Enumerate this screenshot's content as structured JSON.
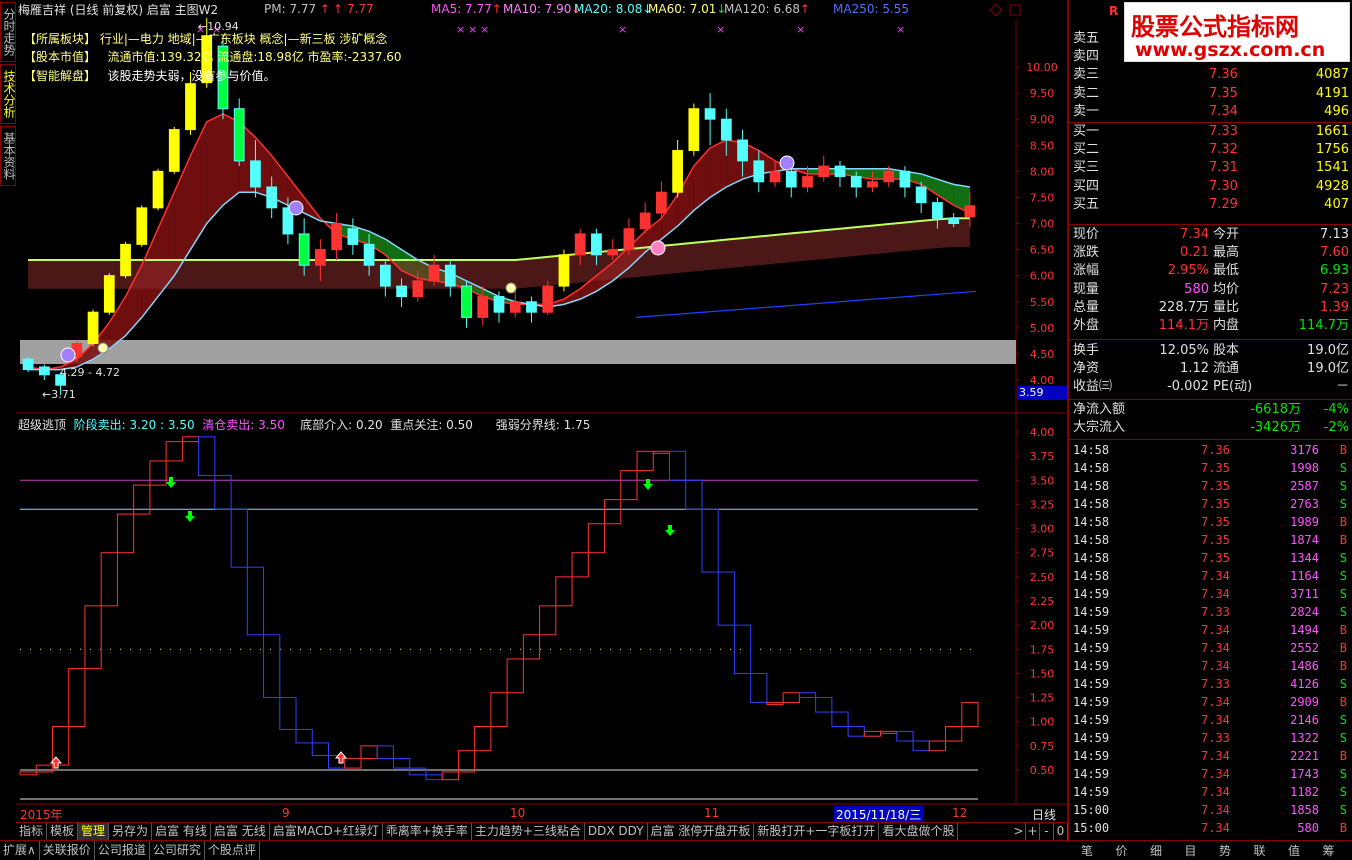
{
  "side_tabs": [
    "分时走势",
    "技术分析",
    "基本资料"
  ],
  "header": {
    "stock_name": "梅雁吉祥",
    "chart_mode": "(日线 前复权)",
    "layout": "启富 主图W2",
    "pm_label": "PM: 7.77",
    "pm_value": "7.77",
    "ma5": "MA5: 7.77",
    "ma10": "MA10: 7.90",
    "ma20": "MA20: 8.08",
    "ma60": "MA60: 7.01",
    "ma120": "MA120: 6.68",
    "ma250": "MA250: 5.55",
    "line2": "【所属板块】   行业|—电力   地域|—广东板块   概念|—新三板 涉矿概念",
    "line3_a": "【股本市值】",
    "line3_b": "流通市值:139.32亿   流通盘:18.98亿   市盈率:-2337.60",
    "line4_a": "【智能解盘】",
    "line4_b": "该股走势夫弱，没有参与价值。",
    "peak_label": "10.94",
    "low_label": "3.71",
    "range_label": "4.29 - 4.72"
  },
  "price_axis": [
    "10.00",
    "9.50",
    "9.00",
    "8.50",
    "8.00",
    "7.50",
    "7.00",
    "6.50",
    "6.00",
    "5.50",
    "5.00",
    "4.50",
    "4.00"
  ],
  "price_badge": "3.59",
  "indicator": {
    "title": "超级逃顶",
    "stage_sell": "阶段卖出: 3.20 : 3.50",
    "clear_sell": "清仓卖出: 3.50",
    "bottom_in": "底部介入: 0.20",
    "focus": "重点关注: 0.50",
    "strong_weak": "强弱分界线: 1.75"
  },
  "ind_axis": [
    "4.00",
    "3.75",
    "3.50",
    "3.25",
    "3.00",
    "2.75",
    "2.50",
    "2.25",
    "2.00",
    "1.75",
    "1.50",
    "1.25",
    "1.00",
    "0.75",
    "0.50"
  ],
  "date_axis": {
    "year": "2015年",
    "m9": "9",
    "m10": "10",
    "m11": "11",
    "m12": "12",
    "cursor_date": "2015/11/18/三",
    "period": "日线"
  },
  "toolbar": [
    "指标",
    "模板",
    "管理",
    "另存为",
    "启富 有线",
    "启富 无线",
    "启富MACD+红绿灯",
    "乖离率+换手率",
    "主力趋势+三线粘合",
    "DDX DDY",
    "启富 涨停开盘开板",
    "新股打开+一字板打开",
    "看大盘做个股"
  ],
  "toolbar_nav": [
    ">",
    "+",
    "-",
    "0"
  ],
  "bottom_bar": [
    "扩展∧",
    "关联报价",
    "公司报道",
    "公司研究",
    "个股点评"
  ],
  "logo": {
    "text": "股票公式指标网",
    "url": "www.gszx.com.cn",
    "r": "R",
    "e": "6"
  },
  "order_book": {
    "asks": [
      {
        "label": "卖五",
        "price": "",
        "vol": ""
      },
      {
        "label": "卖四",
        "price": "",
        "vol": "5480"
      },
      {
        "label": "卖三",
        "price": "7.36",
        "vol": "4087"
      },
      {
        "label": "卖二",
        "price": "7.35",
        "vol": "4191"
      },
      {
        "label": "卖一",
        "price": "7.34",
        "vol": "496"
      }
    ],
    "bids": [
      {
        "label": "买一",
        "price": "7.33",
        "vol": "1661"
      },
      {
        "label": "买二",
        "price": "7.32",
        "vol": "1756"
      },
      {
        "label": "买三",
        "price": "7.31",
        "vol": "1541"
      },
      {
        "label": "买四",
        "price": "7.30",
        "vol": "4928"
      },
      {
        "label": "买五",
        "price": "7.29",
        "vol": "407"
      }
    ]
  },
  "quote": [
    {
      "l1": "现价",
      "v1": "7.34",
      "c1": "red",
      "l2": "今开",
      "v2": "7.13",
      "c2": "white"
    },
    {
      "l1": "涨跌",
      "v1": "0.21",
      "c1": "red",
      "l2": "最高",
      "v2": "7.60",
      "c2": "red"
    },
    {
      "l1": "涨幅",
      "v1": "2.95%",
      "c1": "red",
      "l2": "最低",
      "v2": "6.93",
      "c2": "green"
    },
    {
      "l1": "现量",
      "v1": "580",
      "c1": "magenta",
      "l2": "均价",
      "v2": "7.23",
      "c2": "red"
    },
    {
      "l1": "总量",
      "v1": "228.7万",
      "c1": "white",
      "l2": "量比",
      "v2": "1.39",
      "c2": "red"
    },
    {
      "l1": "外盘",
      "v1": "114.1万",
      "c1": "red",
      "l2": "内盘",
      "v2": "114.7万",
      "c2": "green"
    }
  ],
  "fund": [
    {
      "l1": "换手",
      "v1": "12.05%",
      "l2": "股本",
      "v2": "19.0亿"
    },
    {
      "l1": "净资",
      "v1": "1.12",
      "l2": "流通",
      "v2": "19.0亿"
    },
    {
      "l1": "收益㈢",
      "v1": "-0.002",
      "l2": "PE(动)",
      "v2": "－"
    }
  ],
  "flows": [
    {
      "label": "净流入额",
      "value": "-6618万",
      "pct": "-4%"
    },
    {
      "label": "大宗流入",
      "value": "-3426万",
      "pct": "-2%"
    }
  ],
  "ticks": [
    {
      "t": "14:58",
      "p": "7.36",
      "v": "3176",
      "s": "B"
    },
    {
      "t": "14:58",
      "p": "7.35",
      "v": "1998",
      "s": "S"
    },
    {
      "t": "14:58",
      "p": "7.35",
      "v": "2587",
      "s": "S"
    },
    {
      "t": "14:58",
      "p": "7.35",
      "v": "2763",
      "s": "S"
    },
    {
      "t": "14:58",
      "p": "7.35",
      "v": "1989",
      "s": "B"
    },
    {
      "t": "14:58",
      "p": "7.35",
      "v": "1874",
      "s": "B"
    },
    {
      "t": "14:58",
      "p": "7.35",
      "v": "1344",
      "s": "S"
    },
    {
      "t": "14:58",
      "p": "7.34",
      "v": "1164",
      "s": "S"
    },
    {
      "t": "14:59",
      "p": "7.34",
      "v": "3711",
      "s": "S"
    },
    {
      "t": "14:59",
      "p": "7.33",
      "v": "2824",
      "s": "S"
    },
    {
      "t": "14:59",
      "p": "7.34",
      "v": "1494",
      "s": "B"
    },
    {
      "t": "14:59",
      "p": "7.34",
      "v": "2552",
      "s": "B"
    },
    {
      "t": "14:59",
      "p": "7.34",
      "v": "1486",
      "s": "B"
    },
    {
      "t": "14:59",
      "p": "7.33",
      "v": "4126",
      "s": "S"
    },
    {
      "t": "14:59",
      "p": "7.34",
      "v": "2909",
      "s": "B"
    },
    {
      "t": "14:59",
      "p": "7.34",
      "v": "2146",
      "s": "S"
    },
    {
      "t": "14:59",
      "p": "7.33",
      "v": "1322",
      "s": "S"
    },
    {
      "t": "14:59",
      "p": "7.34",
      "v": "2221",
      "s": "B"
    },
    {
      "t": "14:59",
      "p": "7.34",
      "v": "1743",
      "s": "S"
    },
    {
      "t": "14:59",
      "p": "7.34",
      "v": "1182",
      "s": "S"
    },
    {
      "t": "15:00",
      "p": "7.34",
      "v": "1858",
      "s": "S"
    },
    {
      "t": "15:00",
      "p": "7.34",
      "v": "580",
      "s": "B"
    }
  ],
  "right_tabs": [
    "笔",
    "价",
    "细",
    "目",
    "势",
    "联",
    "值",
    "筹"
  ],
  "colors": {
    "up": "#ff3232",
    "down": "#54ffff",
    "yellow": "#ffff00",
    "border": "#800000"
  },
  "chart_data": {
    "type": "candlestick",
    "candles": [
      {
        "o": 4.4,
        "c": 4.2,
        "h": 4.45,
        "l": 4.15
      },
      {
        "o": 4.25,
        "c": 4.1,
        "h": 4.3,
        "l": 4.0
      },
      {
        "o": 4.1,
        "c": 3.9,
        "h": 4.15,
        "l": 3.71
      },
      {
        "o": 4.45,
        "c": 4.7,
        "h": 4.75,
        "l": 4.35
      },
      {
        "o": 4.7,
        "c": 5.3,
        "h": 5.35,
        "l": 4.65
      },
      {
        "o": 5.3,
        "c": 6.0,
        "h": 6.05,
        "l": 5.25
      },
      {
        "o": 6.0,
        "c": 6.6,
        "h": 6.65,
        "l": 5.95
      },
      {
        "o": 6.6,
        "c": 7.3,
        "h": 7.35,
        "l": 6.55
      },
      {
        "o": 7.3,
        "c": 8.0,
        "h": 8.05,
        "l": 7.25
      },
      {
        "o": 8.0,
        "c": 8.8,
        "h": 8.85,
        "l": 7.95
      },
      {
        "o": 8.8,
        "c": 9.68,
        "h": 9.9,
        "l": 8.7
      },
      {
        "o": 9.7,
        "c": 10.6,
        "h": 10.94,
        "l": 9.6
      },
      {
        "o": 10.4,
        "c": 9.2,
        "h": 10.6,
        "l": 9.0
      },
      {
        "o": 9.2,
        "c": 8.2,
        "h": 9.4,
        "l": 8.1
      },
      {
        "o": 8.2,
        "c": 7.7,
        "h": 8.6,
        "l": 7.5
      },
      {
        "o": 7.7,
        "c": 7.3,
        "h": 7.9,
        "l": 7.1
      },
      {
        "o": 7.3,
        "c": 6.8,
        "h": 7.5,
        "l": 6.6
      },
      {
        "o": 6.8,
        "c": 6.2,
        "h": 7.1,
        "l": 6.0
      },
      {
        "o": 6.2,
        "c": 6.5,
        "h": 6.7,
        "l": 5.9
      },
      {
        "o": 6.5,
        "c": 7.0,
        "h": 7.2,
        "l": 6.3
      },
      {
        "o": 6.9,
        "c": 6.6,
        "h": 7.1,
        "l": 6.4
      },
      {
        "o": 6.6,
        "c": 6.2,
        "h": 6.8,
        "l": 6.0
      },
      {
        "o": 6.2,
        "c": 5.8,
        "h": 6.3,
        "l": 5.6
      },
      {
        "o": 5.8,
        "c": 5.6,
        "h": 5.95,
        "l": 5.4
      },
      {
        "o": 5.6,
        "c": 5.9,
        "h": 6.1,
        "l": 5.5
      },
      {
        "o": 5.9,
        "c": 6.2,
        "h": 6.4,
        "l": 5.8
      },
      {
        "o": 6.2,
        "c": 5.8,
        "h": 6.3,
        "l": 5.6
      },
      {
        "o": 5.8,
        "c": 5.2,
        "h": 5.9,
        "l": 5.0
      },
      {
        "o": 5.2,
        "c": 5.6,
        "h": 5.8,
        "l": 5.05
      },
      {
        "o": 5.6,
        "c": 5.3,
        "h": 5.7,
        "l": 5.1
      },
      {
        "o": 5.3,
        "c": 5.5,
        "h": 5.75,
        "l": 5.2
      },
      {
        "o": 5.5,
        "c": 5.3,
        "h": 5.6,
        "l": 5.1
      },
      {
        "o": 5.3,
        "c": 5.8,
        "h": 5.9,
        "l": 5.25
      },
      {
        "o": 5.8,
        "c": 6.4,
        "h": 6.5,
        "l": 5.7
      },
      {
        "o": 6.4,
        "c": 6.8,
        "h": 6.9,
        "l": 6.2
      },
      {
        "o": 6.8,
        "c": 6.4,
        "h": 6.9,
        "l": 6.2
      },
      {
        "o": 6.4,
        "c": 6.5,
        "h": 6.7,
        "l": 6.3
      },
      {
        "o": 6.5,
        "c": 6.9,
        "h": 7.1,
        "l": 6.4
      },
      {
        "o": 6.9,
        "c": 7.2,
        "h": 7.4,
        "l": 6.8
      },
      {
        "o": 7.2,
        "c": 7.6,
        "h": 7.8,
        "l": 7.1
      },
      {
        "o": 7.6,
        "c": 8.4,
        "h": 8.6,
        "l": 7.5
      },
      {
        "o": 8.4,
        "c": 9.2,
        "h": 9.3,
        "l": 8.3
      },
      {
        "o": 9.2,
        "c": 9.0,
        "h": 9.5,
        "l": 8.5
      },
      {
        "o": 9.0,
        "c": 8.6,
        "h": 9.2,
        "l": 8.3
      },
      {
        "o": 8.6,
        "c": 8.2,
        "h": 8.8,
        "l": 7.9
      },
      {
        "o": 8.2,
        "c": 7.8,
        "h": 8.4,
        "l": 7.6
      },
      {
        "o": 7.8,
        "c": 8.0,
        "h": 8.2,
        "l": 7.7
      },
      {
        "o": 8.0,
        "c": 7.7,
        "h": 8.1,
        "l": 7.5
      },
      {
        "o": 7.7,
        "c": 7.9,
        "h": 8.1,
        "l": 7.6
      },
      {
        "o": 7.9,
        "c": 8.1,
        "h": 8.3,
        "l": 7.8
      },
      {
        "o": 8.1,
        "c": 7.9,
        "h": 8.2,
        "l": 7.7
      },
      {
        "o": 7.9,
        "c": 7.7,
        "h": 8.0,
        "l": 7.5
      },
      {
        "o": 7.7,
        "c": 7.8,
        "h": 8.0,
        "l": 7.6
      },
      {
        "o": 7.8,
        "c": 8.0,
        "h": 8.1,
        "l": 7.7
      },
      {
        "o": 8.0,
        "c": 7.7,
        "h": 8.1,
        "l": 7.5
      },
      {
        "o": 7.7,
        "c": 7.4,
        "h": 7.8,
        "l": 7.2
      },
      {
        "o": 7.4,
        "c": 7.1,
        "h": 7.5,
        "l": 6.9
      },
      {
        "o": 7.1,
        "c": 7.0,
        "h": 7.2,
        "l": 6.93
      },
      {
        "o": 7.13,
        "c": 7.34,
        "h": 7.6,
        "l": 6.93
      }
    ],
    "ma_fast": [
      4.25,
      4.2,
      4.25,
      4.4,
      4.7,
      5.1,
      5.6,
      6.2,
      6.9,
      7.6,
      8.3,
      8.95,
      9.1,
      8.95,
      8.65,
      8.3,
      7.9,
      7.5,
      7.1,
      6.8,
      6.7,
      6.6,
      6.4,
      6.1,
      5.95,
      5.9,
      5.85,
      5.75,
      5.6,
      5.5,
      5.45,
      5.45,
      5.45,
      5.55,
      5.75,
      6.0,
      6.25,
      6.55,
      6.85,
      7.1,
      7.55,
      8.1,
      8.45,
      8.6,
      8.55,
      8.4,
      8.2,
      8.05,
      7.95,
      7.95,
      7.95,
      7.9,
      7.85,
      7.85,
      7.85,
      7.75,
      7.55,
      7.35,
      7.2
    ],
    "ma_slow": [
      4.2,
      4.2,
      4.2,
      4.25,
      4.4,
      4.6,
      4.85,
      5.2,
      5.6,
      6.0,
      6.5,
      7.0,
      7.35,
      7.6,
      7.6,
      7.5,
      7.35,
      7.2,
      7.05,
      7.0,
      6.95,
      6.85,
      6.7,
      6.5,
      6.3,
      6.15,
      6.05,
      5.9,
      5.75,
      5.6,
      5.5,
      5.45,
      5.4,
      5.45,
      5.55,
      5.7,
      5.9,
      6.15,
      6.45,
      6.7,
      6.95,
      7.25,
      7.5,
      7.7,
      7.85,
      7.95,
      8.0,
      8.05,
      8.05,
      8.05,
      8.05,
      8.05,
      8.05,
      8.05,
      8.0,
      7.95,
      7.85,
      7.75,
      7.7
    ],
    "indicator_series": [
      0.45,
      0.48,
      0.55,
      0.95,
      1.55,
      2.2,
      2.75,
      3.15,
      3.45,
      3.7,
      3.9,
      3.95,
      3.55,
      3.2,
      2.6,
      1.9,
      1.25,
      0.92,
      0.78,
      0.65,
      0.52,
      0.62,
      0.75,
      0.62,
      0.52,
      0.45,
      0.4,
      0.48,
      0.7,
      0.95,
      1.3,
      1.65,
      1.9,
      2.2,
      2.5,
      2.75,
      3.05,
      3.3,
      3.6,
      3.8,
      3.8,
      3.5,
      3.2,
      2.55,
      2.0,
      1.5,
      1.2,
      1.2,
      1.3,
      1.25,
      1.1,
      0.95,
      0.85,
      0.9,
      0.9,
      0.8,
      0.7,
      0.8,
      0.95,
      1.2
    ]
  }
}
